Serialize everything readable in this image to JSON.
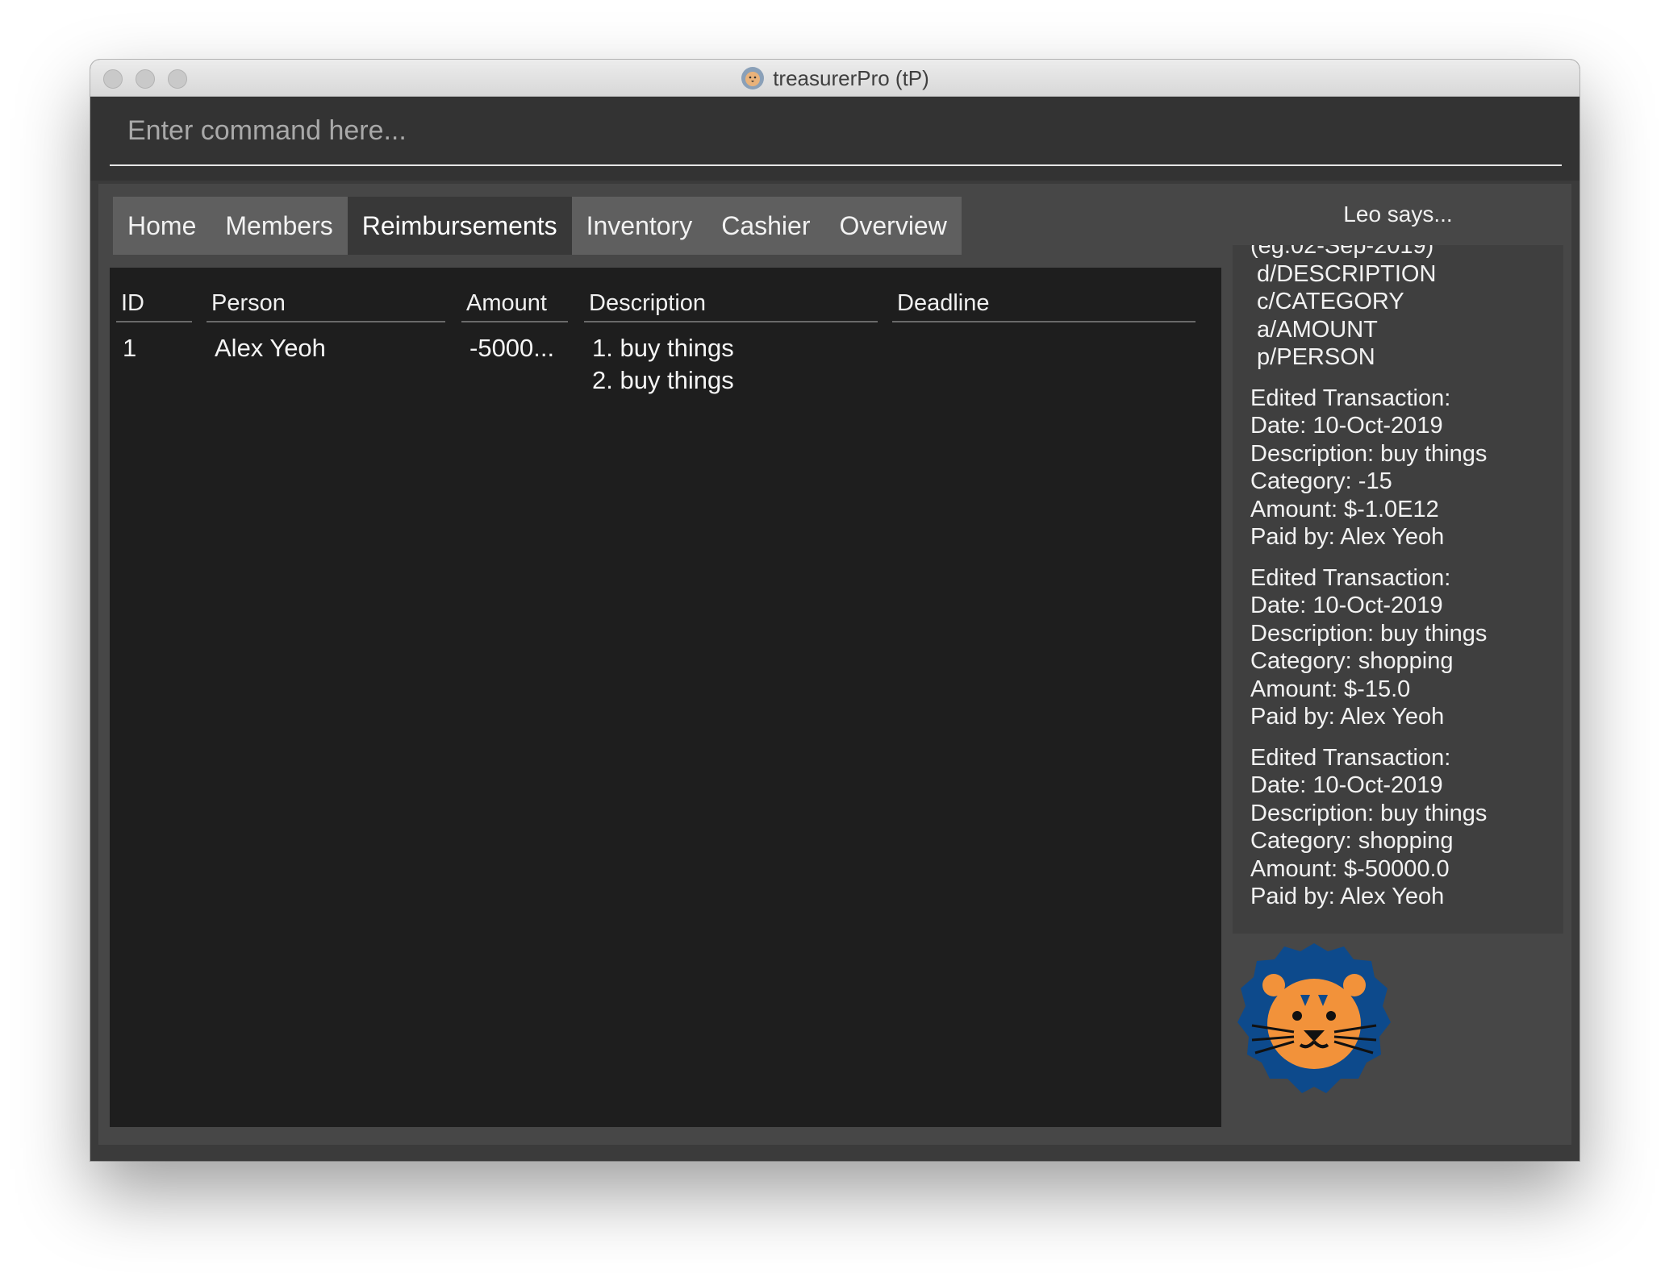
{
  "window": {
    "title": "treasurerPro (tP)"
  },
  "command": {
    "placeholder": "Enter command here..."
  },
  "tabs": [
    {
      "label": "Home",
      "active": false
    },
    {
      "label": "Members",
      "active": false
    },
    {
      "label": "Reimbursements",
      "active": true
    },
    {
      "label": "Inventory",
      "active": false
    },
    {
      "label": "Cashier",
      "active": false
    },
    {
      "label": "Overview",
      "active": false
    }
  ],
  "table": {
    "columns": [
      "ID",
      "Person",
      "Amount",
      "Description",
      "Deadline"
    ],
    "rows": [
      {
        "id": "1",
        "person": "Alex Yeoh",
        "amount": "-5000...",
        "description": [
          "1. buy things",
          "2. buy things"
        ],
        "deadline": ""
      }
    ]
  },
  "assistant": {
    "header": "Leo says...",
    "messages": [
      [
        "(eg.02-Sep-2019)",
        " d/DESCRIPTION",
        " c/CATEGORY",
        " a/AMOUNT",
        " p/PERSON"
      ],
      [
        "Edited Transaction:",
        "Date: 10-Oct-2019",
        "Description: buy things",
        "Category: -15",
        "Amount: $-1.0E12",
        "Paid by: Alex Yeoh"
      ],
      [
        "Edited Transaction:",
        "Date: 10-Oct-2019",
        "Description: buy things",
        "Category: shopping",
        "Amount: $-15.0",
        "Paid by: Alex Yeoh"
      ],
      [
        "Edited Transaction:",
        "Date: 10-Oct-2019",
        "Description: buy things",
        "Category: shopping",
        "Amount: $-50000.0",
        "Paid by: Alex Yeoh"
      ]
    ]
  },
  "colors": {
    "lion_mane": "#0d4a8c",
    "lion_face": "#f2923a",
    "active_tab": "#383838",
    "table_bg": "#1e1e1e"
  },
  "icons": [
    "app-lion-icon",
    "lion-mascot-icon"
  ]
}
